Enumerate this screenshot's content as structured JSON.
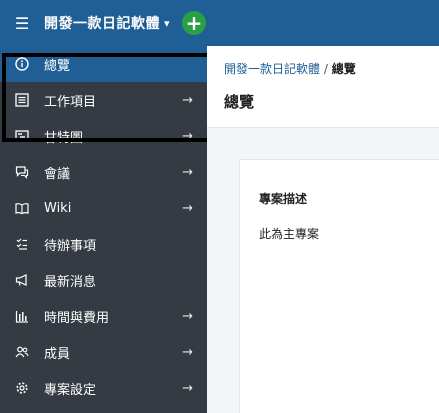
{
  "topbar": {
    "menu_icon": "hamburger-icon",
    "project_name": "開發一款日記軟體",
    "caret": "▾",
    "add_icon": "plus-icon"
  },
  "sidebar": {
    "items": [
      {
        "label": "總覽",
        "icon": "info-icon",
        "arrow": ""
      },
      {
        "label": "工作項目",
        "icon": "list-icon",
        "arrow": "→"
      },
      {
        "label": "甘特圖",
        "icon": "gantt-icon",
        "arrow": "→"
      },
      {
        "label": "會議",
        "icon": "chat-icon",
        "arrow": "→"
      },
      {
        "label": "Wiki",
        "icon": "book-icon",
        "arrow": "→"
      },
      {
        "label": "待辦事項",
        "icon": "checklist-icon",
        "arrow": ""
      },
      {
        "label": "最新消息",
        "icon": "megaphone-icon",
        "arrow": ""
      },
      {
        "label": "時間與費用",
        "icon": "bar-chart-icon",
        "arrow": "→"
      },
      {
        "label": "成員",
        "icon": "members-icon",
        "arrow": "→"
      },
      {
        "label": "專案設定",
        "icon": "gear-icon",
        "arrow": "→"
      }
    ]
  },
  "breadcrumb": {
    "project": "開發一款日記軟體",
    "sep": " / ",
    "current": "總覽"
  },
  "page": {
    "title": "總覽"
  },
  "card": {
    "title": "專案描述",
    "body": "此為主專案"
  },
  "colors": {
    "topbar": "#1f5f96",
    "sidebar": "#353b42",
    "active": "#1f5f96",
    "add_button": "#2aa046"
  }
}
